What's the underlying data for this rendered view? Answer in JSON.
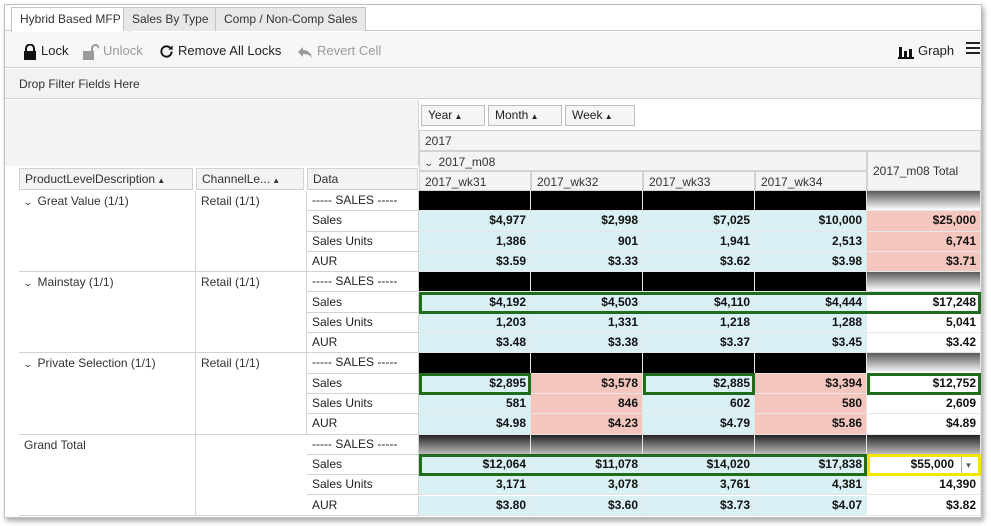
{
  "tabs": [
    {
      "label": "Hybrid Based MFP",
      "active": true
    },
    {
      "label": "Sales By Type",
      "active": false
    },
    {
      "label": "Comp / Non-Comp Sales",
      "active": false
    }
  ],
  "toolbar": {
    "lock": "Lock",
    "unlock": "Unlock",
    "remove_all_locks": "Remove All Locks",
    "revert_cell": "Revert Cell",
    "graph": "Graph"
  },
  "filter_bar": "Drop Filter Fields Here",
  "pivot": {
    "column_fields": [
      "Year",
      "Month",
      "Week"
    ],
    "row_fields": [
      "ProductLevelDescription",
      "ChannelLe...",
      "Data"
    ],
    "year": "2017",
    "month": "2017_m08",
    "weeks": [
      "2017_wk31",
      "2017_wk32",
      "2017_wk33",
      "2017_wk34"
    ],
    "total_header": "2017_m08 Total",
    "groups": [
      {
        "product": "Great Value (1/1)",
        "channel": "Retail (1/1)",
        "rows": [
          {
            "label": "----- SALES -----",
            "values": [
              "",
              "",
              "",
              "",
              ""
            ]
          },
          {
            "label": "Sales",
            "values": [
              "$4,977",
              "$2,998",
              "$7,025",
              "$10,000",
              "$25,000"
            ]
          },
          {
            "label": "Sales Units",
            "values": [
              "1,386",
              "901",
              "1,941",
              "2,513",
              "6,741"
            ]
          },
          {
            "label": "AUR",
            "values": [
              "$3.59",
              "$3.33",
              "$3.62",
              "$3.98",
              "$3.71"
            ]
          }
        ]
      },
      {
        "product": "Mainstay (1/1)",
        "channel": "Retail (1/1)",
        "rows": [
          {
            "label": "----- SALES -----",
            "values": [
              "",
              "",
              "",
              "",
              ""
            ]
          },
          {
            "label": "Sales",
            "values": [
              "$4,192",
              "$4,503",
              "$4,110",
              "$4,444",
              "$17,248"
            ]
          },
          {
            "label": "Sales Units",
            "values": [
              "1,203",
              "1,331",
              "1,218",
              "1,288",
              "5,041"
            ]
          },
          {
            "label": "AUR",
            "values": [
              "$3.48",
              "$3.38",
              "$3.37",
              "$3.45",
              "$3.42"
            ]
          }
        ]
      },
      {
        "product": "Private Selection (1/1)",
        "channel": "Retail (1/1)",
        "rows": [
          {
            "label": "----- SALES -----",
            "values": [
              "",
              "",
              "",
              "",
              ""
            ]
          },
          {
            "label": "Sales",
            "values": [
              "$2,895",
              "$3,578",
              "$2,885",
              "$3,394",
              "$12,752"
            ]
          },
          {
            "label": "Sales Units",
            "values": [
              "581",
              "846",
              "602",
              "580",
              "2,609"
            ]
          },
          {
            "label": "AUR",
            "values": [
              "$4.98",
              "$4.23",
              "$4.79",
              "$5.86",
              "$4.89"
            ]
          }
        ]
      },
      {
        "product": "Grand Total",
        "channel": "",
        "rows": [
          {
            "label": "----- SALES -----",
            "values": [
              "",
              "",
              "",
              "",
              ""
            ]
          },
          {
            "label": "Sales",
            "values": [
              "$12,064",
              "$11,078",
              "$14,020",
              "$17,838",
              "$55,000"
            ]
          },
          {
            "label": "Sales Units",
            "values": [
              "3,171",
              "3,078",
              "3,761",
              "4,381",
              "14,390"
            ]
          },
          {
            "label": "AUR",
            "values": [
              "$3.80",
              "$3.60",
              "$3.73",
              "$4.07",
              "$3.82"
            ]
          }
        ]
      }
    ]
  },
  "colors": {
    "cell_blue": "#d9f0f4",
    "cell_pink": "#f4c6be",
    "highlight_green": "#1f6d1c",
    "highlight_yellow": "#f5e400"
  }
}
